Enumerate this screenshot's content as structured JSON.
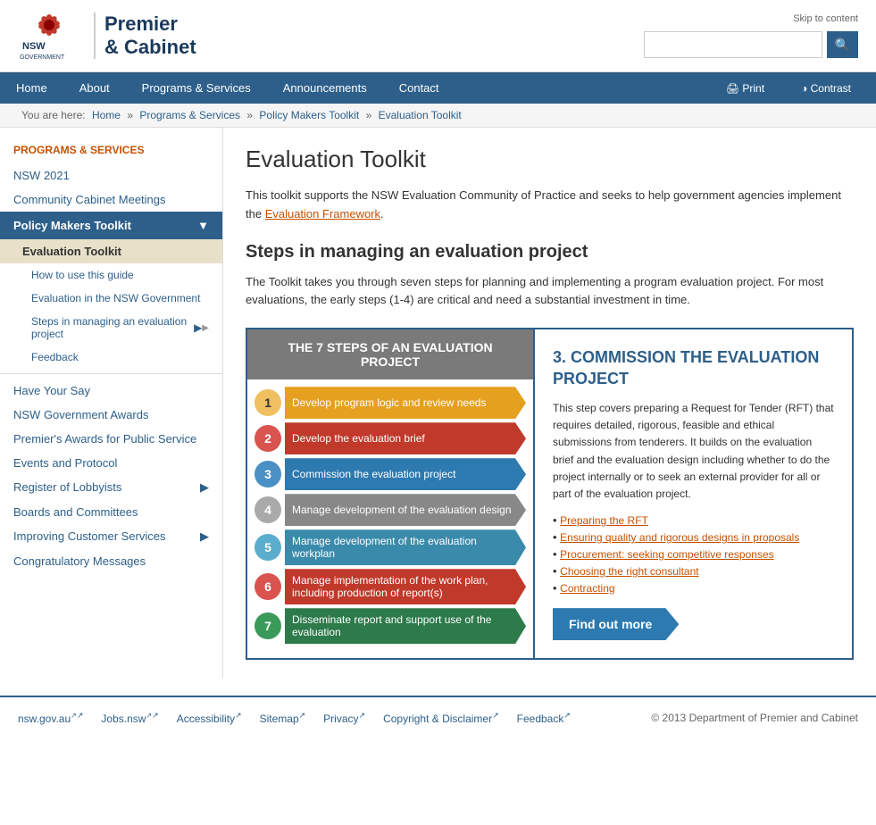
{
  "header": {
    "skip_link": "Skip to content",
    "logo_line1": "Premier",
    "logo_line2": "& Cabinet",
    "search_placeholder": "",
    "search_btn_icon": "🔍"
  },
  "nav": {
    "items": [
      {
        "label": "Home",
        "href": "#"
      },
      {
        "label": "About",
        "href": "#"
      },
      {
        "label": "Programs & Services",
        "href": "#"
      },
      {
        "label": "Announcements",
        "href": "#"
      },
      {
        "label": "Contact",
        "href": "#"
      }
    ],
    "print_label": "Print",
    "contrast_label": "Contrast"
  },
  "breadcrumb": {
    "items": [
      {
        "label": "Home",
        "href": "#"
      },
      {
        "label": "Programs & Services",
        "href": "#"
      },
      {
        "label": "Policy Makers Toolkit",
        "href": "#"
      },
      {
        "label": "Evaluation Toolkit",
        "href": "#"
      }
    ]
  },
  "sidebar": {
    "section_title": "PROGRAMS & SERVICES",
    "items": [
      {
        "label": "NSW 2021",
        "href": "#",
        "type": "link"
      },
      {
        "label": "Community Cabinet Meetings",
        "href": "#",
        "type": "link"
      },
      {
        "label": "Policy Makers Toolkit",
        "href": "#",
        "type": "active-parent"
      },
      {
        "label": "Evaluation Toolkit",
        "href": "#",
        "type": "active-item"
      },
      {
        "label": "How to use this guide",
        "href": "#",
        "type": "sub"
      },
      {
        "label": "Evaluation in the NSW Government",
        "href": "#",
        "type": "sub"
      },
      {
        "label": "Steps in managing an evaluation project",
        "href": "#",
        "type": "sub-arrow"
      },
      {
        "label": "Feedback",
        "href": "#",
        "type": "sub"
      },
      {
        "label": "Have Your Say",
        "href": "#",
        "type": "link"
      },
      {
        "label": "NSW Government Awards",
        "href": "#",
        "type": "link"
      },
      {
        "label": "Premier's Awards for Public Service",
        "href": "#",
        "type": "link"
      },
      {
        "label": "Events and Protocol",
        "href": "#",
        "type": "link"
      },
      {
        "label": "Register of Lobbyists",
        "href": "#",
        "type": "link-arrow"
      },
      {
        "label": "Boards and Committees",
        "href": "#",
        "type": "link"
      },
      {
        "label": "Improving Customer Services",
        "href": "#",
        "type": "link-arrow"
      },
      {
        "label": "Congratulatory Messages",
        "href": "#",
        "type": "link"
      }
    ]
  },
  "main": {
    "page_title": "Evaluation Toolkit",
    "intro_text_1": "This toolkit supports the NSW Evaluation Community of Practice and seeks to help government agencies implement the Evaluation Framework.",
    "intro_link_text": "Evaluation Framework",
    "steps_heading": "Steps in managing an evaluation project",
    "steps_desc": "The Toolkit takes you through seven steps for planning and implementing a program evaluation project. For most evaluations, the early steps (1-4) are critical and need a substantial investment in time.",
    "steps_box_header": "THE 7 STEPS OF AN EVALUATION PROJECT",
    "steps": [
      {
        "number": "1",
        "label": "Develop program logic and review needs",
        "color_class": "step-1",
        "num_class": "step-number-1"
      },
      {
        "number": "2",
        "label": "Develop the evaluation brief",
        "color_class": "step-2",
        "num_class": "step-number-2"
      },
      {
        "number": "3",
        "label": "Commission the evaluation project",
        "color_class": "step-3",
        "num_class": "step-number-3"
      },
      {
        "number": "4",
        "label": "Manage development of the evaluation design",
        "color_class": "step-4",
        "num_class": "step-number-4"
      },
      {
        "number": "5",
        "label": "Manage development of the evaluation workplan",
        "color_class": "step-5",
        "num_class": "step-number-5"
      },
      {
        "number": "6",
        "label": "Manage implementation of the work plan, including production of report(s)",
        "color_class": "step-6",
        "num_class": "step-number-6"
      },
      {
        "number": "7",
        "label": "Disseminate report and support use of the evaluation",
        "color_class": "step-7",
        "num_class": "step-number-7"
      }
    ],
    "commission_title": "3. COMMISSION THE EVALUATION PROJECT",
    "commission_desc": "This step covers preparing a Request for Tender (RFT) that requires detailed, rigorous, feasible and ethical submissions from tenderers. It builds on the evaluation brief and the evaluation design including whether to do the project internally or to seek an external provider for all or part of the evaluation project.",
    "commission_links": [
      {
        "label": "Preparing the RFT"
      },
      {
        "label": "Ensuring quality and rigorous designs in proposals"
      },
      {
        "label": "Procurement: seeking competitive responses"
      },
      {
        "label": "Choosing the right consultant"
      },
      {
        "label": "Contracting"
      }
    ],
    "find_out_label": "Find out more"
  },
  "footer": {
    "links": [
      {
        "label": "nsw.gov.au"
      },
      {
        "label": "Jobs.nsw"
      }
    ],
    "plain_links": [
      {
        "label": "Accessibility"
      },
      {
        "label": "Sitemap"
      },
      {
        "label": "Privacy"
      },
      {
        "label": "Copyright & Disclaimer"
      },
      {
        "label": "Feedback"
      }
    ],
    "copyright": "© 2013 Department of Premier and Cabinet"
  }
}
